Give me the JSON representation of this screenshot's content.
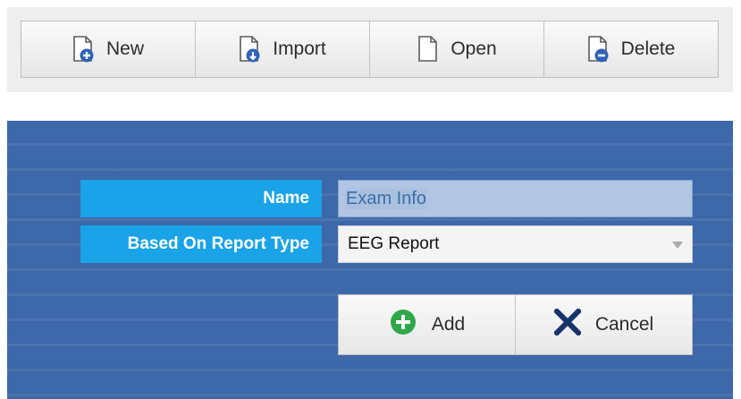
{
  "toolbar": {
    "buttons": [
      {
        "label": "New",
        "icon": "new-document-icon"
      },
      {
        "label": "Import",
        "icon": "import-document-icon"
      },
      {
        "label": "Open",
        "icon": "open-document-icon"
      },
      {
        "label": "Delete",
        "icon": "delete-document-icon"
      }
    ]
  },
  "dialog": {
    "name_label": "Name",
    "name_value": "Exam Info",
    "report_type_label": "Based On Report Type",
    "report_type_value": "EEG Report",
    "add_label": "Add",
    "cancel_label": "Cancel"
  },
  "colors": {
    "panel_background": "#3d68a9",
    "label_background": "#1aa3e6",
    "add_icon": "#2fa84a",
    "cancel_icon": "#16346b",
    "doc_icon_accent": "#2f63b5"
  }
}
